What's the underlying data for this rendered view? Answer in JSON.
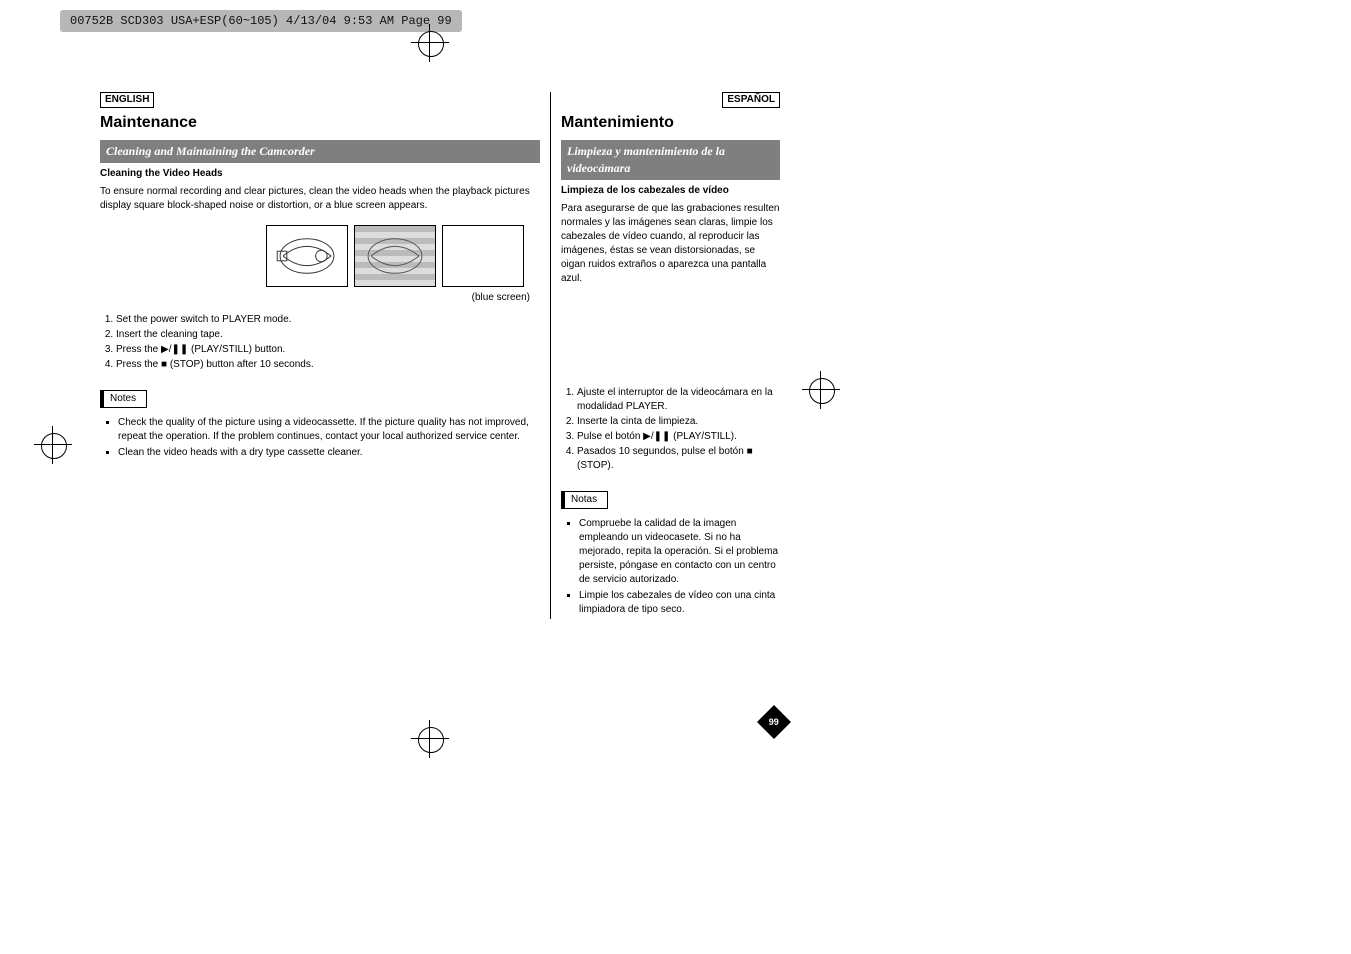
{
  "print_header": "00752B SCD303 USA+ESP(60~105)  4/13/04 9:53 AM  Page 99",
  "page_number": "99",
  "figure_caption": "(blue screen)",
  "english": {
    "lang_label": "ENGLISH",
    "title": "Maintenance",
    "subtitle_bar": "Cleaning and Maintaining the Camcorder",
    "subheading": "Cleaning the Video Heads",
    "intro": "To ensure normal recording and clear pictures, clean the video heads when the playback pictures display square block-shaped noise or distortion, or a blue screen appears.",
    "steps": [
      "Set the power switch to PLAYER mode.",
      "Insert the cleaning tape.",
      "Press the ▶/❚❚ (PLAY/STILL) button.",
      "Press the ■ (STOP) button after 10 seconds."
    ],
    "notes_label": "Notes",
    "notes": [
      "Check the quality of the picture using a videocassette. If the picture quality has not improved, repeat the operation. If the problem continues, contact your local authorized service center.",
      "Clean the video heads with a dry type cassette cleaner."
    ]
  },
  "spanish": {
    "lang_label": "ESPAÑOL",
    "title": "Mantenimiento",
    "subtitle_bar": "Limpieza y mantenimiento de la videocámara",
    "subheading": "Limpieza de los cabezales de vídeo",
    "intro": "Para asegurarse de que las grabaciones resulten normales y las imágenes sean claras, limpie los cabezales de vídeo cuando, al reproducir las imágenes, éstas se vean distorsionadas, se oigan ruidos extraños o aparezca una pantalla azul.",
    "steps": [
      "Ajuste el interruptor de la videocámara en la modalidad PLAYER.",
      "Inserte la cinta de limpieza.",
      "Pulse el botón ▶/❚❚ (PLAY/STILL).",
      "Pasados 10 segundos, pulse el botón ■ (STOP)."
    ],
    "notes_label": "Notas",
    "notes": [
      "Compruebe la calidad de la imagen empleando un videocasete. Si no ha mejorado, repita la operación. Si el problema persiste, póngase en contacto con un centro de servicio autorizado.",
      "Limpie los cabezales de vídeo con una cinta limpiadora de tipo seco."
    ]
  }
}
